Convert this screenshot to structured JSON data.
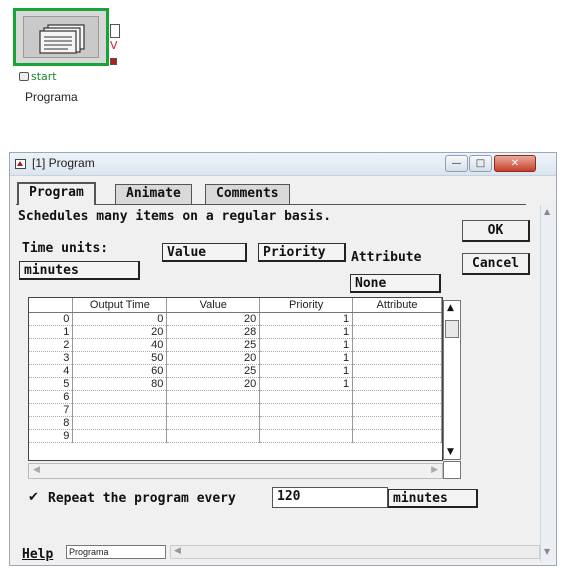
{
  "block": {
    "start_label": "start",
    "name": "Programa",
    "v_label": "V"
  },
  "window": {
    "title": "[1]  Program",
    "tabs": [
      "Program",
      "Animate",
      "Comments"
    ],
    "description": "Schedules many items on a regular basis.",
    "time_units_label": "Time units:",
    "time_units_value": "minutes",
    "value_button": "Value",
    "priority_button": "Priority",
    "attribute_label": "Attribute",
    "attribute_value": "None",
    "ok_label": "OK",
    "cancel_label": "Cancel",
    "grid": {
      "columns": [
        "",
        "Output Time",
        "Value",
        "Priority",
        "Attribute"
      ],
      "rows": [
        {
          "idx": "0",
          "time": "0",
          "value": "20",
          "priority": "1",
          "attribute": ""
        },
        {
          "idx": "1",
          "time": "20",
          "value": "28",
          "priority": "1",
          "attribute": ""
        },
        {
          "idx": "2",
          "time": "40",
          "value": "25",
          "priority": "1",
          "attribute": ""
        },
        {
          "idx": "3",
          "time": "50",
          "value": "20",
          "priority": "1",
          "attribute": ""
        },
        {
          "idx": "4",
          "time": "60",
          "value": "25",
          "priority": "1",
          "attribute": ""
        },
        {
          "idx": "5",
          "time": "80",
          "value": "20",
          "priority": "1",
          "attribute": ""
        },
        {
          "idx": "6",
          "time": "",
          "value": "",
          "priority": "",
          "attribute": ""
        },
        {
          "idx": "7",
          "time": "",
          "value": "",
          "priority": "",
          "attribute": ""
        },
        {
          "idx": "8",
          "time": "",
          "value": "",
          "priority": "",
          "attribute": ""
        },
        {
          "idx": "9",
          "time": "",
          "value": "",
          "priority": "",
          "attribute": ""
        }
      ]
    },
    "repeat_checked": true,
    "repeat_label": "Repeat the program every",
    "repeat_value": "120",
    "repeat_units": "minutes",
    "help_label": "Help",
    "status_text": "Programa"
  }
}
